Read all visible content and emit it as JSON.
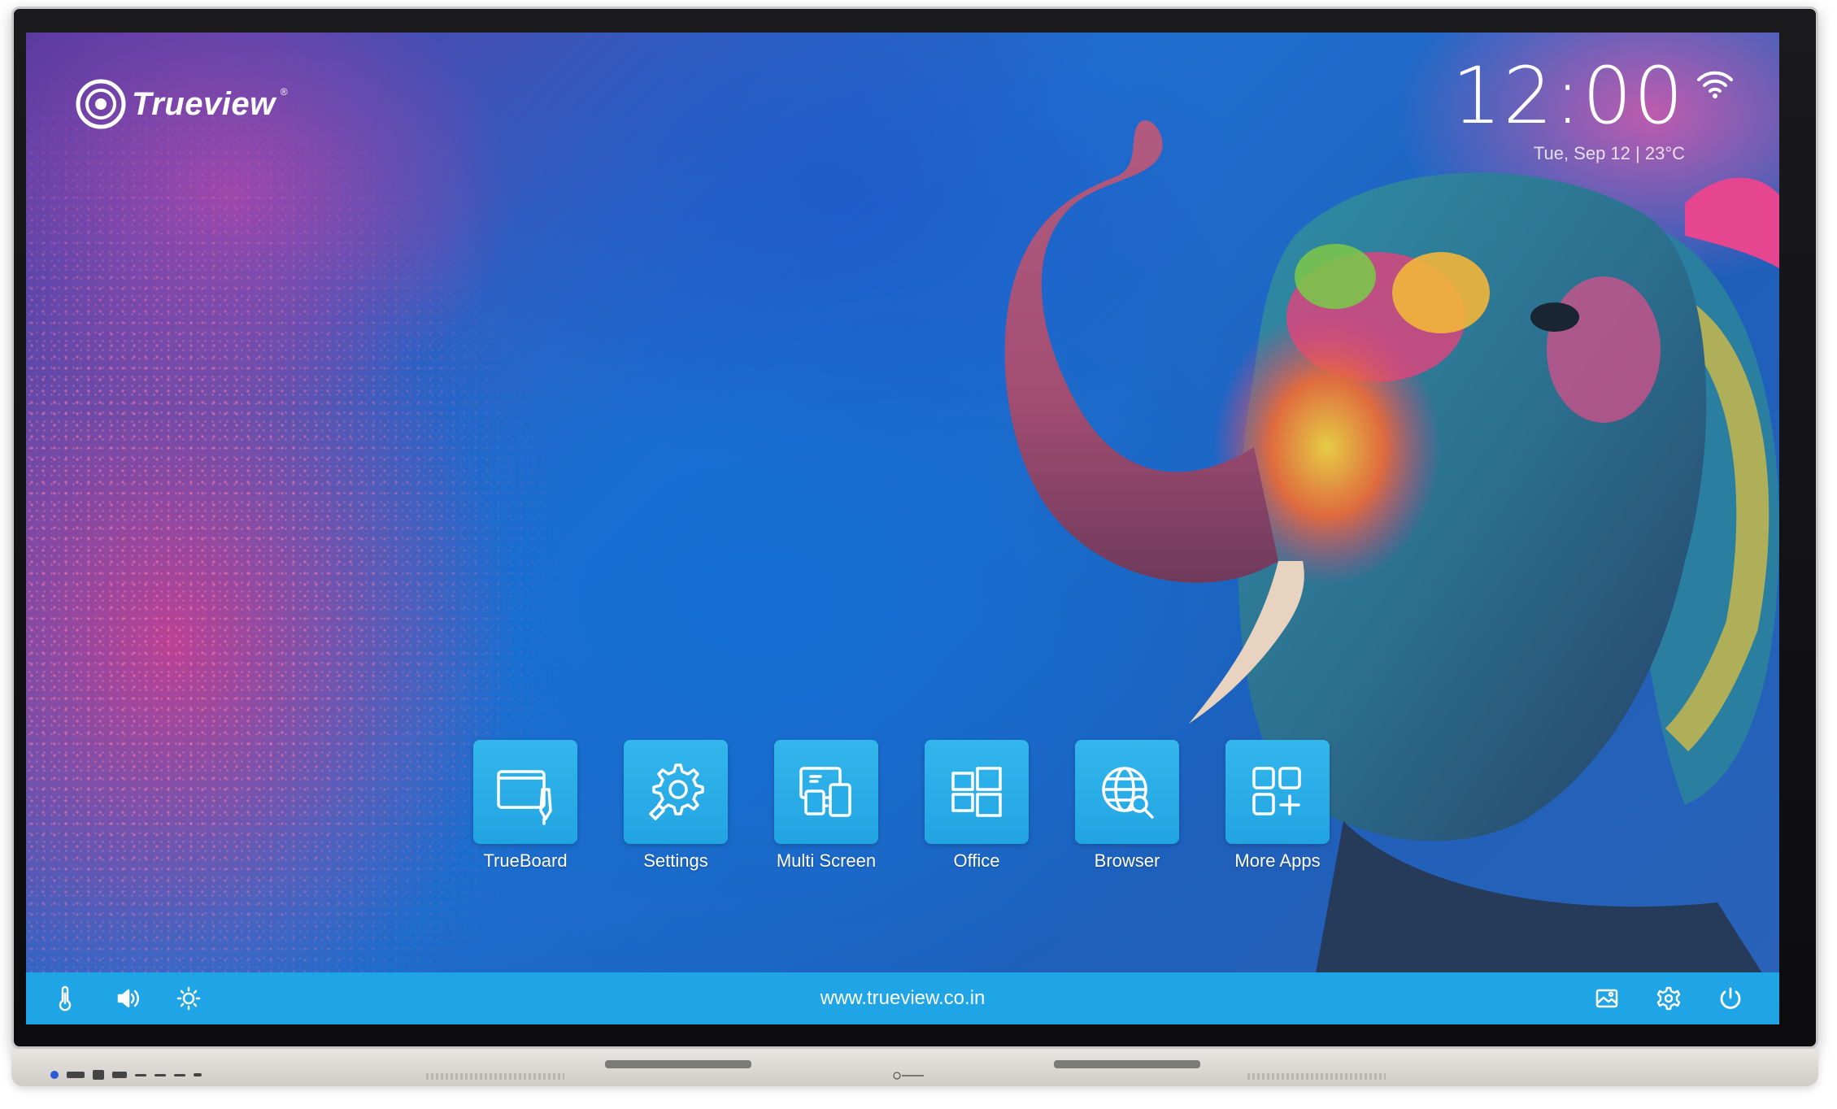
{
  "brand": {
    "name": "Trueview",
    "registered": "®"
  },
  "status": {
    "time": "12:00",
    "date": "Tue, Sep 12 | 23°C",
    "wifi_icon": "wifi-icon"
  },
  "apps": [
    {
      "label": "TrueBoard",
      "icon": "whiteboard-pen-icon"
    },
    {
      "label": "Settings",
      "icon": "gear-wrench-icon"
    },
    {
      "label": "Multi Screen",
      "icon": "multi-screen-icon"
    },
    {
      "label": "Office",
      "icon": "windows-icon"
    },
    {
      "label": "Browser",
      "icon": "globe-search-icon"
    },
    {
      "label": "More Apps",
      "icon": "more-apps-icon"
    }
  ],
  "bottom_bar": {
    "url": "www.trueview.co.in",
    "left_icons": [
      "thermometer-icon",
      "volume-icon",
      "brightness-icon"
    ],
    "right_icons": [
      "wallpaper-icon",
      "settings-icon",
      "power-icon"
    ]
  },
  "colors": {
    "accent": "#1fa5e6",
    "tile": "#2aaee8"
  }
}
